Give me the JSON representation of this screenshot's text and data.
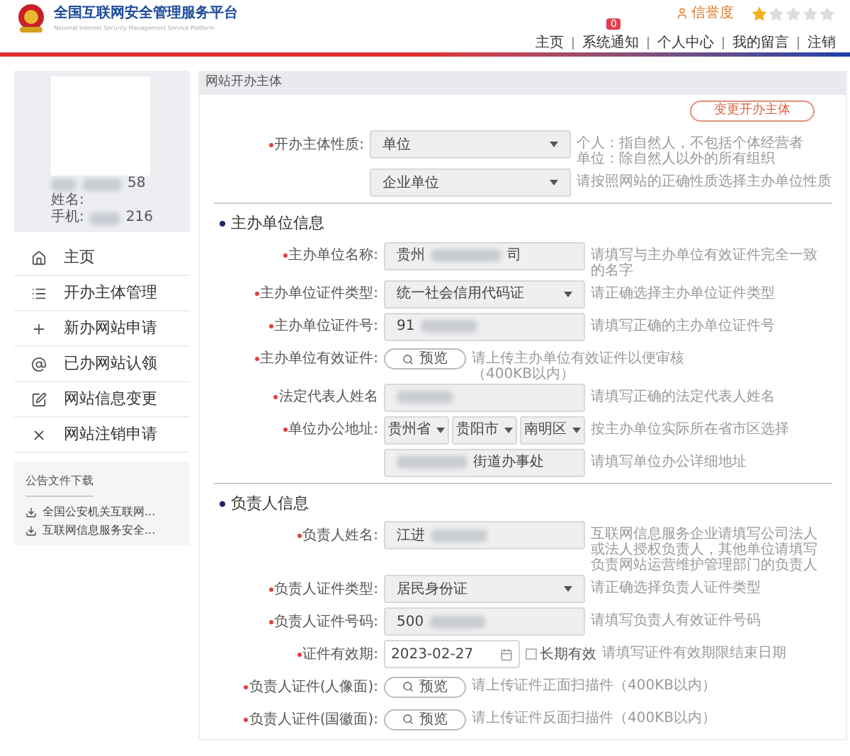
{
  "header": {
    "title": "全国互联网安全管理服务平台",
    "subtitle": "National Internet Security Management Service Platform",
    "reputation_label": "信誉度",
    "stars": 1,
    "nav": [
      {
        "label": "主页"
      },
      {
        "label": "系统通知",
        "badge": "0"
      },
      {
        "label": "个人中心"
      },
      {
        "label": "我的留言"
      },
      {
        "label": "注销"
      }
    ]
  },
  "profile": {
    "lines": [
      {
        "value": "58"
      },
      {
        "label": "姓名:"
      },
      {
        "label": "手机:",
        "value": "216"
      }
    ]
  },
  "sidebar": {
    "items": [
      {
        "label": "主页"
      },
      {
        "label": "开办主体管理"
      },
      {
        "label": "新办网站申请"
      },
      {
        "label": "已办网站认领"
      },
      {
        "label": "网站信息变更"
      },
      {
        "label": "网站注销申请"
      }
    ],
    "downloads_title": "公告文件下载",
    "downloads": [
      "全国公安机关互联网...",
      "互联网信息服务安全..."
    ]
  },
  "main": {
    "title": "网站开办主体",
    "change_button": "变更开办主体",
    "sections": [
      {
        "rows": [
          {
            "kind": "select",
            "label": "开办主体性质:",
            "value": "单位",
            "hint": [
              "个人：指自然人，不包括个体经营者",
              "单位：除自然人以外的所有组织"
            ]
          },
          {
            "kind": "select",
            "value": "企业单位",
            "hint": [
              "请按照网站的正确性质选择主办单位性质"
            ]
          }
        ]
      },
      {
        "title": "主办单位信息",
        "rows": [
          {
            "kind": "text",
            "label": "主办单位名称:",
            "value": "贵州",
            "value_end": "司",
            "hint": [
              "请填写与主办单位有效证件完全一致的名字"
            ]
          },
          {
            "kind": "select",
            "label": "主办单位证件类型:",
            "value": "统一社会信用代码证",
            "hint": [
              "请正确选择主办单位证件类型"
            ]
          },
          {
            "kind": "text",
            "label": "主办单位证件号:",
            "value": "91",
            "hint": [
              "请填写正确的主办单位证件号"
            ]
          },
          {
            "kind": "upload",
            "label": "主办单位有效证件:",
            "value": "预览",
            "hint": [
              "请上传主办单位有效证件以便审核（400KB以内）"
            ]
          },
          {
            "kind": "text",
            "label": "法定代表人姓名",
            "hint": [
              "请填写正确的法定代表人姓名"
            ]
          },
          {
            "kind": "region",
            "label": "单位办公地址:",
            "values": [
              "贵州省",
              "贵阳市",
              "南明区"
            ],
            "hint": [
              "按主办单位实际所在省市区选择"
            ]
          },
          {
            "kind": "text",
            "value_end": "街道办事处",
            "hint": [
              "请填写单位办公详细地址"
            ]
          }
        ]
      },
      {
        "title": "负责人信息",
        "rows": [
          {
            "kind": "text",
            "label": "负责人姓名:",
            "value": "江进",
            "hint": [
              "互联网信息服务企业请填写公司法人或法人授权负责人，其他单位请填写负责网站运营维护管理部门的负责人"
            ]
          },
          {
            "kind": "select",
            "label": "负责人证件类型:",
            "value": "居民身份证",
            "hint": [
              "请正确选择负责人证件类型"
            ]
          },
          {
            "kind": "text",
            "label": "负责人证件号码:",
            "value": "500",
            "hint": [
              "请填写负责人有效证件号码"
            ]
          },
          {
            "kind": "date",
            "label": "证件有效期:",
            "value": "2023-02-27",
            "checkbox": {
              "label": "长期有效",
              "checked": false
            },
            "hint": [
              "请填写证件有效期限结束日期"
            ]
          },
          {
            "kind": "upload",
            "label": "负责人证件(人像面):",
            "value": "预览",
            "hint": [
              "请上传证件正面扫描件（400KB以内）"
            ]
          },
          {
            "kind": "upload",
            "label": "负责人证件(国徽面):",
            "value": "预览",
            "hint": [
              "请上传证件反面扫描件（400KB以内）"
            ]
          }
        ]
      }
    ]
  }
}
